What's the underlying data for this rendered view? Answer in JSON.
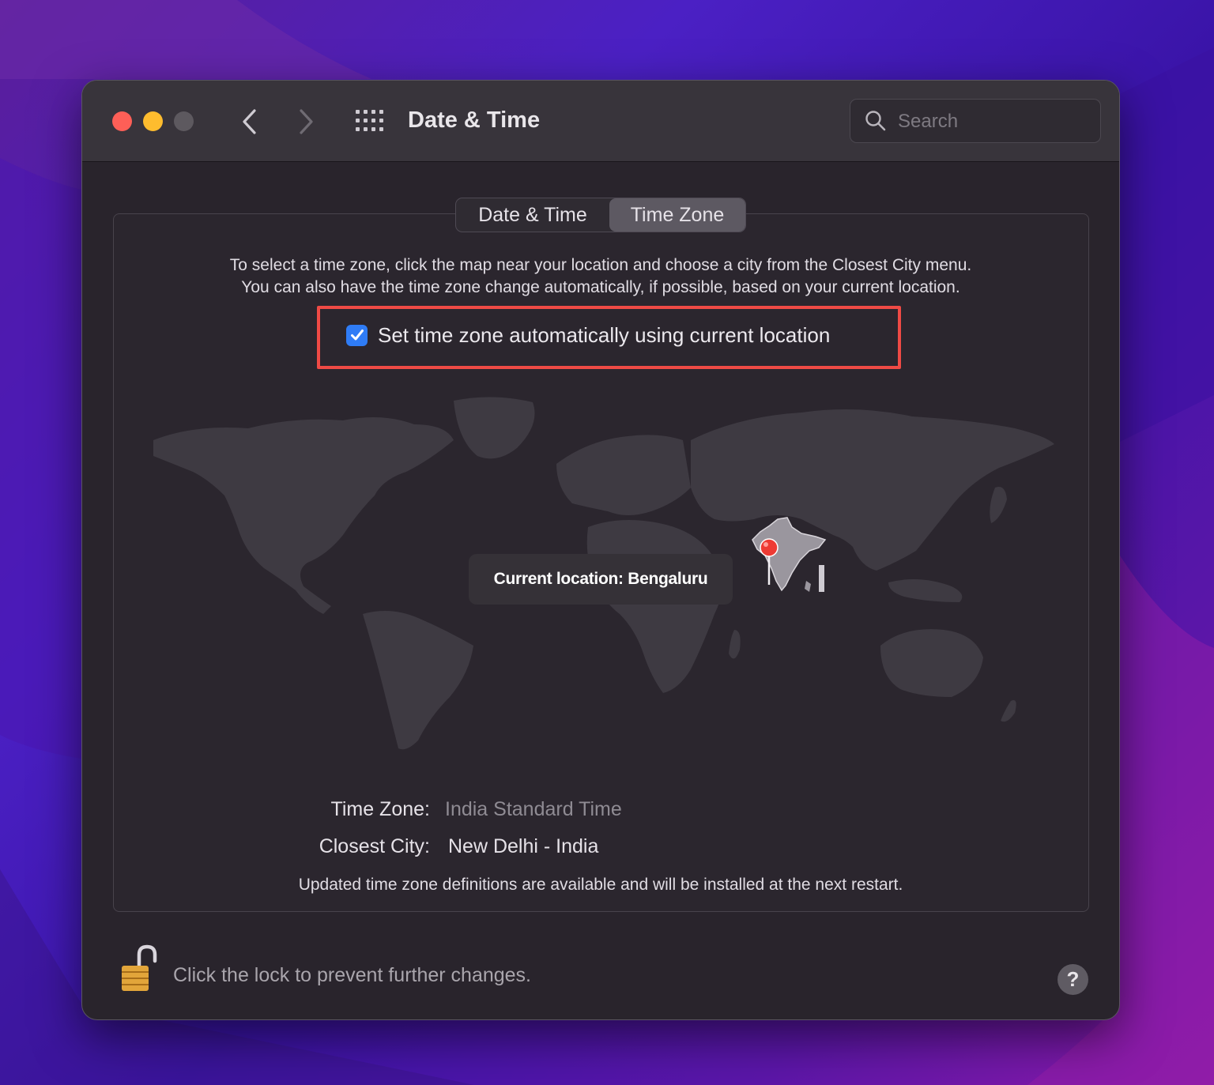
{
  "window": {
    "title": "Date & Time"
  },
  "search": {
    "placeholder": "Search"
  },
  "tabs": [
    {
      "label": "Date & Time"
    },
    {
      "label": "Time Zone"
    }
  ],
  "selected_tab": "Time Zone",
  "description": {
    "line1": "To select a time zone, click the map near your location and choose a city from the Closest City menu.",
    "line2": "You can also have the time zone change automatically, if possible, based on your current location."
  },
  "auto_timezone": {
    "label": "Set time zone automatically using current location",
    "checked": true
  },
  "map": {
    "tooltip": "Current location: Bengaluru"
  },
  "timezone": {
    "label": "Time Zone:",
    "value": "India Standard Time"
  },
  "closest_city": {
    "label": "Closest City:",
    "value": "New Delhi - India"
  },
  "update_note": "Updated time zone definitions are available and will be installed at the next restart.",
  "lock": {
    "text": "Click the lock to prevent further changes."
  },
  "help": {
    "label": "?"
  },
  "colors": {
    "accent": "#2f7cf6",
    "highlight": "#ef4a45",
    "close": "#fe5f57",
    "minimize": "#febc2e",
    "pin": "#ee3b34"
  },
  "icons": {
    "back": "chevron-left-icon",
    "forward": "chevron-right-icon",
    "grid": "grid-icon",
    "search": "search-icon",
    "lock": "lock-open-icon",
    "pin": "map-pin-icon"
  }
}
